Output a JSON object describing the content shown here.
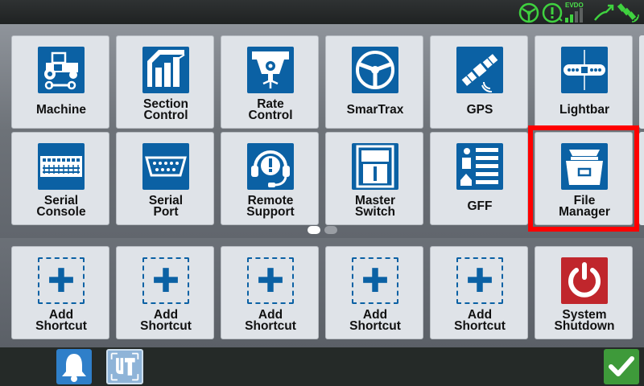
{
  "status": {
    "steering_icon": "steering-wheel-icon",
    "alert_icon": "alert-icon",
    "network_label": "EVDO",
    "signal_bars_active": 2,
    "signal_bars_total": 4,
    "gps_icon": "gps-satellite-icon",
    "accent_color": "#3fd23f"
  },
  "apps": [
    {
      "id": "machine",
      "lines": [
        "Machine",
        ""
      ],
      "icon": "tractor-icon"
    },
    {
      "id": "section-control",
      "lines": [
        "Section",
        "Control"
      ],
      "icon": "section-control-icon"
    },
    {
      "id": "rate-control",
      "lines": [
        "Rate",
        "Control"
      ],
      "icon": "rate-control-icon"
    },
    {
      "id": "smartrax",
      "lines": [
        "SmarTrax",
        ""
      ],
      "icon": "steering-wheel-icon"
    },
    {
      "id": "gps",
      "lines": [
        "GPS",
        ""
      ],
      "icon": "satellite-icon"
    },
    {
      "id": "lightbar",
      "lines": [
        "Lightbar",
        ""
      ],
      "icon": "lightbar-icon"
    },
    {
      "id": "serial-console",
      "lines": [
        "Serial",
        "Console"
      ],
      "icon": "console-icon"
    },
    {
      "id": "serial-port",
      "lines": [
        "Serial",
        "Port"
      ],
      "icon": "serial-port-icon"
    },
    {
      "id": "remote-support",
      "lines": [
        "Remote",
        "Support"
      ],
      "icon": "headset-icon"
    },
    {
      "id": "master-switch",
      "lines": [
        "Master",
        "Switch"
      ],
      "icon": "switch-icon"
    },
    {
      "id": "gff",
      "lines": [
        "GFF",
        ""
      ],
      "icon": "list-icon"
    },
    {
      "id": "file-manager",
      "lines": [
        "File",
        "Manager"
      ],
      "icon": "file-box-icon"
    }
  ],
  "pager": {
    "current": 1,
    "total": 2
  },
  "shortcuts": [
    {
      "lines": [
        "Add",
        "Shortcut"
      ],
      "icon": "plus-icon"
    },
    {
      "lines": [
        "Add",
        "Shortcut"
      ],
      "icon": "plus-icon"
    },
    {
      "lines": [
        "Add",
        "Shortcut"
      ],
      "icon": "plus-icon"
    },
    {
      "lines": [
        "Add",
        "Shortcut"
      ],
      "icon": "plus-icon"
    },
    {
      "lines": [
        "Add",
        "Shortcut"
      ],
      "icon": "plus-icon"
    },
    {
      "lines": [
        "System",
        "Shutdown"
      ],
      "icon": "power-icon"
    }
  ],
  "bottom": {
    "notifications_icon": "bell-icon",
    "ut_icon": "ut-icon",
    "confirm_icon": "checkmark-icon",
    "confirm_color": "#3e9a3a"
  },
  "colors": {
    "icon_blue": "#0b61a4",
    "shutdown_red": "#c0262c",
    "highlight": "#ff0000"
  }
}
